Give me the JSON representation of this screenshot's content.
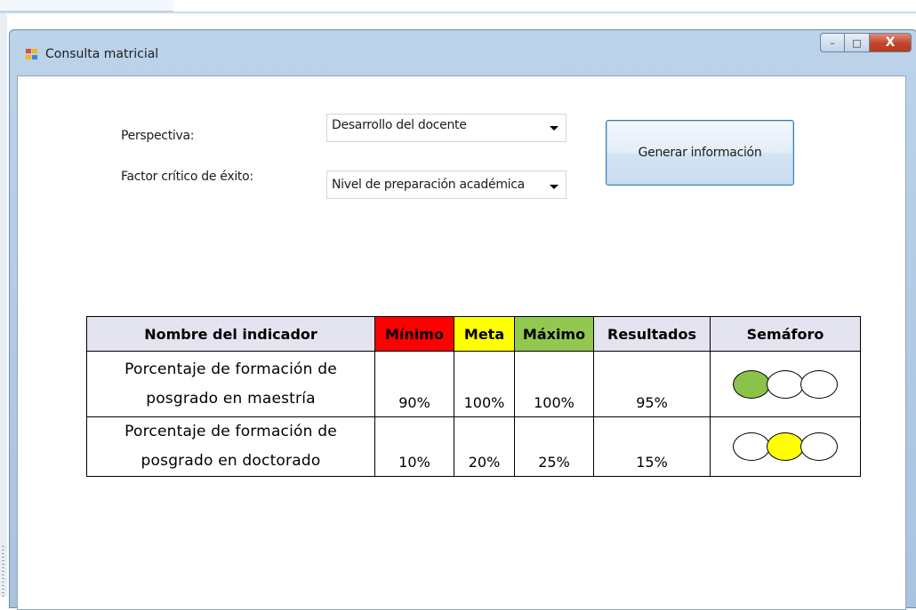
{
  "window": {
    "title": "Consulta matricial",
    "controls": {
      "minimize": "–",
      "maximize": "□",
      "close": "X"
    }
  },
  "form": {
    "perspectiva_label": "Perspectiva:",
    "perspectiva_value": "Desarrollo del docente",
    "factor_label": "Factor crítico de éxito:",
    "factor_value": "Nivel de preparación académica",
    "generate_button": "Generar información"
  },
  "table": {
    "headers": {
      "nombre": "Nombre del indicador",
      "minimo": "Mínimo",
      "meta": "Meta",
      "maximo": "Máximo",
      "resultados": "Resultados",
      "semaforo": "Semáforo"
    },
    "rows": [
      {
        "name_line1": "Porcentaje de formación de",
        "name_line2": "posgrado en maestría",
        "minimo": "90%",
        "meta": "100%",
        "maximo": "100%",
        "resultados": "95%",
        "semaforo": [
          "#8bc34a",
          "#ffffff",
          "#ffffff"
        ]
      },
      {
        "name_line1": "Porcentaje de formación de",
        "name_line2": "posgrado en doctorado",
        "minimo": "10%",
        "meta": "20%",
        "maximo": "25%",
        "resultados": "15%",
        "semaforo": [
          "#ffffff",
          "#ffff00",
          "#ffffff"
        ]
      }
    ]
  },
  "colors": {
    "minimo": "#ff0000",
    "meta": "#ffff00",
    "maximo": "#92c84f",
    "header_bg": "#e4e3f0"
  }
}
